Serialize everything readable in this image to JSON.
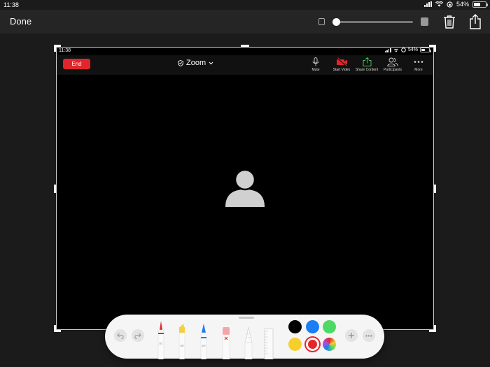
{
  "status_bar": {
    "time": "11:38",
    "battery": "54%",
    "battery_level": 0.54
  },
  "toolbar": {
    "done_label": "Done",
    "opacity_slider_value": 0.0
  },
  "screenshot": {
    "status_bar": {
      "time": "11:38",
      "battery": "54%"
    },
    "zoom": {
      "end_label": "End",
      "title": "Zoom",
      "actions": [
        {
          "label": "Mute",
          "icon": "microphone-icon"
        },
        {
          "label": "Start Video",
          "icon": "video-off-icon"
        },
        {
          "label": "Share Content",
          "icon": "share-content-icon"
        },
        {
          "label": "Participants",
          "icon": "participants-icon"
        },
        {
          "label": "More",
          "icon": "more-icon"
        }
      ]
    }
  },
  "markup": {
    "tools": [
      {
        "name": "pen",
        "color": "#e5262b",
        "label": "97"
      },
      {
        "name": "marker",
        "color": "#f6cf3a",
        "label": "80"
      },
      {
        "name": "pencil",
        "color": "#1a7ef5",
        "label": "50"
      },
      {
        "name": "eraser",
        "color": "#f4a6a6",
        "label": ""
      },
      {
        "name": "lasso",
        "color": "#cfcfcf",
        "label": ""
      },
      {
        "name": "ruler",
        "color": "#d8d8d8",
        "label": ""
      }
    ],
    "colors": [
      "#000000",
      "#1a7ef5",
      "#4cd964",
      "#f6cf2e",
      "#e5262b"
    ],
    "selected_color": "#e5262b",
    "colors_theme": {
      "zoom_end_red": "#e0262c",
      "share_green": "#3ec351",
      "video_red": "#e0262c"
    }
  }
}
